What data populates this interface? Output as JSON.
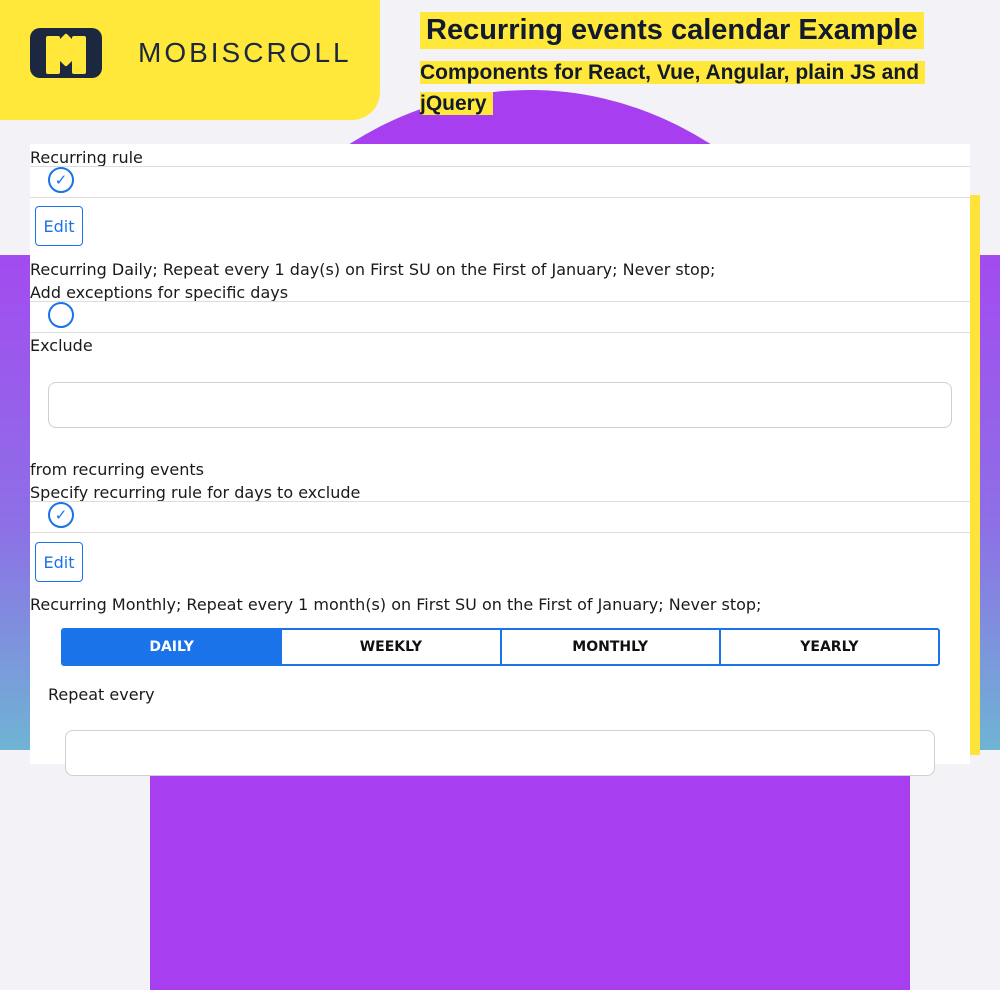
{
  "brand": {
    "name": "MOBISCROLL",
    "icon": "mobiscroll-logo-icon"
  },
  "header": {
    "title": "Recurring events calendar Example",
    "subtitle": "Components for React, Vue, Angular, plain JS and jQuery"
  },
  "colors": {
    "accent": "#1a73e8",
    "brand_yellow": "#ffe83a",
    "brand_dark": "#1b2840",
    "purple": "#a73ff0"
  },
  "form": {
    "recurring_rule_label": "Recurring rule",
    "recurring_rule_checked": true,
    "edit_label": "Edit",
    "rule_summary": "Recurring Daily; Repeat every 1 day(s) on First SU on the First of January; Never stop;",
    "exceptions_label": "Add exceptions for specific days",
    "exceptions_checked": false,
    "exclude_label": "Exclude",
    "exclude_value": "",
    "from_recurring_label": "from recurring events",
    "exclude_rule_label": "Specify recurring rule for days to exclude",
    "exclude_rule_checked": true,
    "exclude_edit_label": "Edit",
    "exclude_rule_summary": "Recurring Monthly; Repeat every 1 month(s) on First SU on the First of January; Never stop;",
    "frequency_tabs": [
      "DAILY",
      "WEEKLY",
      "MONTHLY",
      "YEARLY"
    ],
    "frequency_selected": "DAILY",
    "repeat_every_label": "Repeat every"
  }
}
